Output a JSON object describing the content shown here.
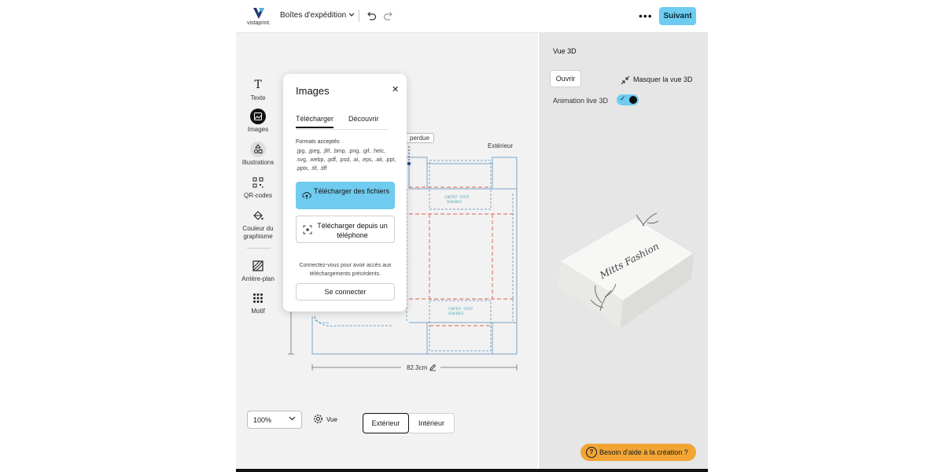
{
  "header": {
    "logo_text": "vistaprint.",
    "doc_title": "Boîtes d'expédition",
    "next_label": "Suivant"
  },
  "sidebar": {
    "tools": [
      {
        "label": "Texte",
        "icon": "text-icon"
      },
      {
        "label": "Images",
        "icon": "image-icon"
      },
      {
        "label": "Illustrations",
        "icon": "shapes-icon"
      },
      {
        "label": "QR-codes",
        "icon": "qr-code-icon"
      },
      {
        "label": "Couleur du graphisme",
        "icon": "paint-bucket-icon"
      },
      {
        "label": "Arrière-plan",
        "icon": "background-icon"
      },
      {
        "label": "Motif",
        "icon": "pattern-icon"
      }
    ]
  },
  "images_panel": {
    "title": "Images",
    "close_icon": "close-icon",
    "tabs": [
      "Télécharger",
      "Découvrir"
    ],
    "active_tab": "Télécharger",
    "formats_title": "Formats acceptés",
    "formats_list": ".jpg, .jpeg, .jfif, .bmp, .png, .gif, .heic, .svg, .webp, .pdf, .psd, .ai, .eps, .ait, .ppt, .pptx, .tif, .tiff",
    "upload_files_label": "Télécharger des fichiers",
    "upload_phone_label": "Télécharger depuis un téléphone",
    "login_note": "Connectez-vous pour avoir accès aux téléchargements précédents.",
    "login_label": "Se connecter"
  },
  "canvas": {
    "bleed_label": "perdue",
    "exterior_label": "Extérieur",
    "width_dimension": "82.3cm"
  },
  "bottom_bar": {
    "zoom_value": "100%",
    "view_label": "Vue",
    "exterior_tab": "Extérieur",
    "interior_tab": "Intérieur"
  },
  "preview_panel": {
    "title": "Vue 3D",
    "open_label": "Ouvrir",
    "hide_label": "Masquer la vue 3D",
    "animation_label": "Animation live 3D",
    "animation_on": true,
    "box_text": "Mitts Fashion",
    "help_label": "Besoin d'aide à la création ?"
  },
  "colors": {
    "accent": "#6fcbf0",
    "help": "#f2a535",
    "dieline": "#7aa6c9",
    "fold_line": "#e08070"
  }
}
